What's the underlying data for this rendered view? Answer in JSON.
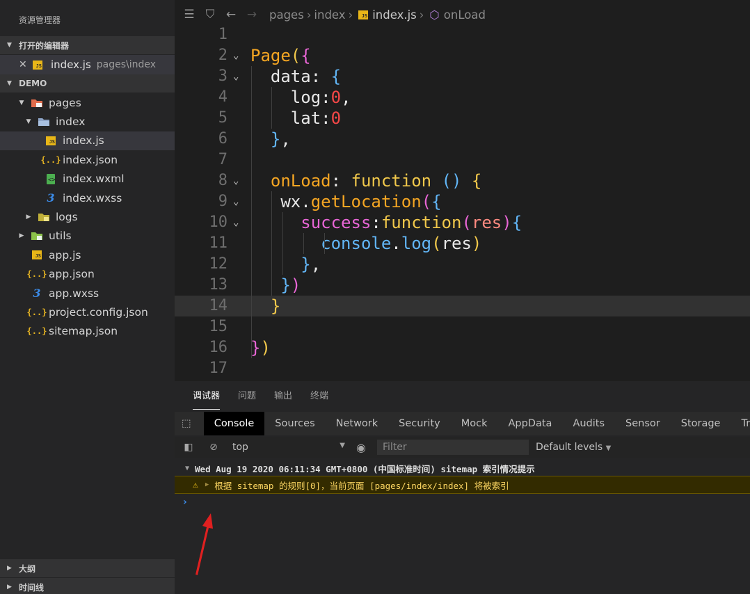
{
  "sidebar": {
    "title": "资源管理器",
    "open_editors_label": "打开的编辑器",
    "open_file": {
      "name": "index.js",
      "path": "pages\\index"
    },
    "project_label": "DEMO",
    "tree": [
      {
        "label": "pages",
        "icon": "folder-pages-icon",
        "arrow": "▼",
        "depth": 0
      },
      {
        "label": "index",
        "icon": "folder-open-icon",
        "arrow": "▼",
        "depth": 1
      },
      {
        "label": "index.js",
        "icon": "js-icon",
        "arrow": "",
        "depth": 2
      },
      {
        "label": "index.json",
        "icon": "json-icon",
        "arrow": "",
        "depth": 2
      },
      {
        "label": "index.wxml",
        "icon": "wxml-icon",
        "arrow": "",
        "depth": 2
      },
      {
        "label": "index.wxss",
        "icon": "css-icon",
        "arrow": "",
        "depth": 2
      },
      {
        "label": "logs",
        "icon": "folder-icon",
        "arrow": "▶",
        "depth": 1
      },
      {
        "label": "utils",
        "icon": "folder-utils-icon",
        "arrow": "▶",
        "depth": 0
      },
      {
        "label": "app.js",
        "icon": "js-icon",
        "arrow": "",
        "depth": 0
      },
      {
        "label": "app.json",
        "icon": "json-icon",
        "arrow": "",
        "depth": 0
      },
      {
        "label": "app.wxss",
        "icon": "css-icon",
        "arrow": "",
        "depth": 0
      },
      {
        "label": "project.config.json",
        "icon": "json-icon",
        "arrow": "",
        "depth": 0
      },
      {
        "label": "sitemap.json",
        "icon": "json-icon",
        "arrow": "",
        "depth": 0
      }
    ],
    "outline_label": "大纲",
    "timeline_label": "时间线"
  },
  "breadcrumb": {
    "items": [
      "pages",
      "index",
      "index.js",
      "onLoad"
    ]
  },
  "editor": {
    "line_numbers": [
      "1",
      "2",
      "3",
      "4",
      "5",
      "6",
      "7",
      "8",
      "9",
      "10",
      "11",
      "12",
      "13",
      "14",
      "15",
      "16",
      "17"
    ],
    "lines": [
      {
        "p": []
      },
      {
        "p": [
          [
            "Page",
            "kw"
          ],
          [
            "(",
            "b3"
          ],
          [
            "{",
            "b1"
          ]
        ]
      },
      {
        "p": [
          [
            "  data",
            "prop"
          ],
          [
            ": ",
            "prop"
          ],
          [
            "{",
            "b2"
          ]
        ]
      },
      {
        "p": [
          [
            "    log",
            "prop"
          ],
          [
            ":",
            "prop"
          ],
          [
            "0",
            "num"
          ],
          [
            ",",
            "prop"
          ]
        ]
      },
      {
        "p": [
          [
            "    lat",
            "prop"
          ],
          [
            ":",
            "prop"
          ],
          [
            "0",
            "num"
          ]
        ]
      },
      {
        "p": [
          [
            "  ",
            "prop"
          ],
          [
            "}",
            "b2"
          ],
          [
            ",",
            "prop"
          ]
        ]
      },
      {
        "p": []
      },
      {
        "p": [
          [
            "  onLoad",
            "kw"
          ],
          [
            ": ",
            "prop"
          ],
          [
            "function",
            "fn"
          ],
          [
            " ",
            "prop"
          ],
          [
            "()",
            "b2"
          ],
          [
            " ",
            "prop"
          ],
          [
            "{",
            "b3"
          ]
        ]
      },
      {
        "p": [
          [
            "   wx",
            "prop"
          ],
          [
            ".",
            "prop"
          ],
          [
            "getLocation",
            "kw"
          ],
          [
            "(",
            "b1"
          ],
          [
            "{",
            "b2"
          ]
        ]
      },
      {
        "p": [
          [
            "     success",
            "b1"
          ],
          [
            ":",
            "prop"
          ],
          [
            "function",
            "fn"
          ],
          [
            "(",
            "b1"
          ],
          [
            "res",
            "par"
          ],
          [
            ")",
            "b1"
          ],
          [
            "{",
            "b2"
          ]
        ]
      },
      {
        "p": [
          [
            "       console",
            "b2"
          ],
          [
            ".",
            "prop"
          ],
          [
            "log",
            "b2"
          ],
          [
            "(",
            "b3"
          ],
          [
            "res",
            "prop"
          ],
          [
            ")",
            "b3"
          ]
        ]
      },
      {
        "p": [
          [
            "     ",
            "prop"
          ],
          [
            "}",
            "b2"
          ],
          [
            ",",
            "prop"
          ]
        ]
      },
      {
        "p": [
          [
            "   ",
            "prop"
          ],
          [
            "}",
            "b2"
          ],
          [
            ")",
            "b1"
          ]
        ]
      },
      {
        "p": [
          [
            "  ",
            "prop"
          ],
          [
            "}",
            "b3"
          ]
        ]
      },
      {
        "p": []
      },
      {
        "p": [
          [
            "}",
            "b1"
          ],
          [
            ")",
            "b3"
          ]
        ]
      },
      {
        "p": []
      }
    ]
  },
  "panel": {
    "tabs": [
      "调试器",
      "问题",
      "输出",
      "终端"
    ],
    "devtools_tabs": [
      "Console",
      "Sources",
      "Network",
      "Security",
      "Mock",
      "AppData",
      "Audits",
      "Sensor",
      "Storage",
      "Trace"
    ],
    "context": "top",
    "filter_placeholder": "Filter",
    "levels": "Default levels",
    "group_header": "Wed Aug 19 2020 06:11:34 GMT+0800 (中国标准时间) sitemap 索引情况提示",
    "warning": "根据 sitemap 的规则[0]，当前页面 [pages/index/index] 将被索引",
    "prompt": "›"
  },
  "colors": {
    "accent_keyword": "#f5a623",
    "warning_bg": "#332b00",
    "arrow_annotation": "#e02020"
  }
}
